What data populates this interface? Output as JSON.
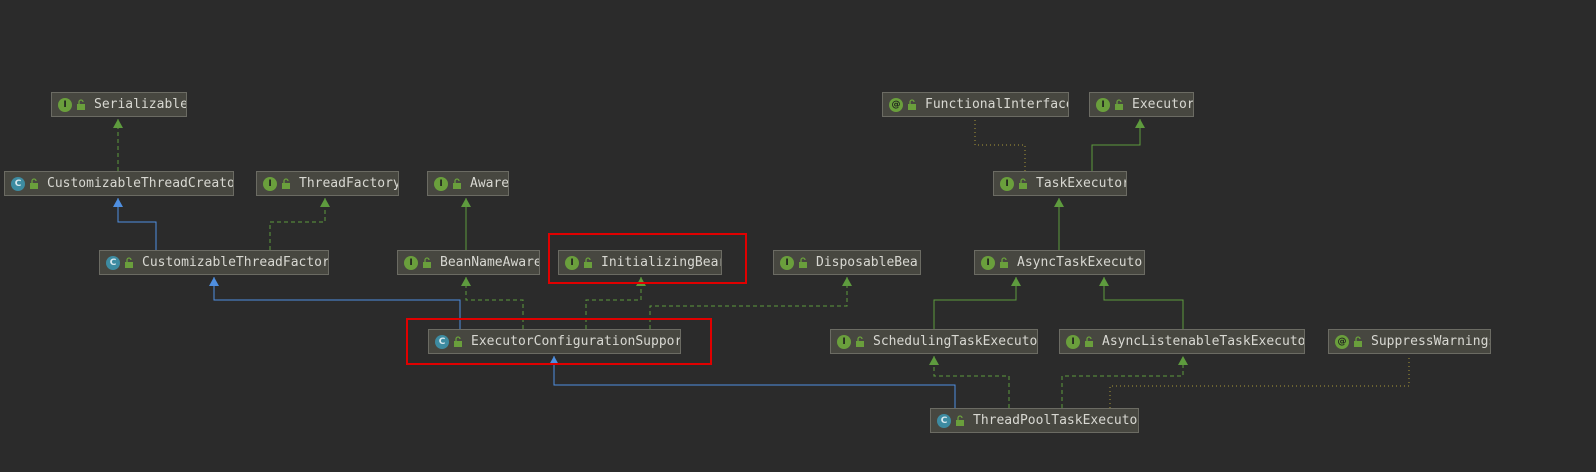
{
  "diagram": {
    "nodes": [
      {
        "id": "serializable",
        "label": "Serializable",
        "kind": "interface",
        "kind_glyph": "I"
      },
      {
        "id": "customizable-thread-creator",
        "label": "CustomizableThreadCreato",
        "kind": "class",
        "kind_glyph": "C"
      },
      {
        "id": "thread-factory",
        "label": "ThreadFactory",
        "kind": "interface",
        "kind_glyph": "I"
      },
      {
        "id": "customizable-thread-factory",
        "label": "CustomizableThreadFactor",
        "kind": "class",
        "kind_glyph": "C"
      },
      {
        "id": "aware",
        "label": "Aware",
        "kind": "interface",
        "kind_glyph": "I"
      },
      {
        "id": "bean-name-aware",
        "label": "BeanNameAware",
        "kind": "interface",
        "kind_glyph": "I"
      },
      {
        "id": "initializing-bean",
        "label": "InitializingBear",
        "kind": "interface",
        "kind_glyph": "I"
      },
      {
        "id": "disposable-bean",
        "label": "DisposableBear",
        "kind": "interface",
        "kind_glyph": "I"
      },
      {
        "id": "executor-configuration-support",
        "label": "ExecutorConfigurationSuppor",
        "kind": "class",
        "kind_glyph": "C"
      },
      {
        "id": "functional-interface",
        "label": "FunctionalInterface",
        "kind": "annotation",
        "kind_glyph": "@"
      },
      {
        "id": "executor",
        "label": "Executor",
        "kind": "interface",
        "kind_glyph": "I"
      },
      {
        "id": "task-executor",
        "label": "TaskExecutor",
        "kind": "interface",
        "kind_glyph": "I"
      },
      {
        "id": "async-task-executor",
        "label": "AsyncTaskExecutor",
        "kind": "interface",
        "kind_glyph": "I"
      },
      {
        "id": "scheduling-task-executor",
        "label": "SchedulingTaskExecuto",
        "kind": "interface",
        "kind_glyph": "I"
      },
      {
        "id": "async-listenable-task-executor",
        "label": "AsyncListenableTaskExecuto",
        "kind": "interface",
        "kind_glyph": "I"
      },
      {
        "id": "suppress-warnings",
        "label": "SuppressWarnings",
        "kind": "annotation",
        "kind_glyph": "@"
      },
      {
        "id": "thread-pool-task-executor",
        "label": "ThreadPoolTaskExecuto",
        "kind": "class",
        "kind_glyph": "C"
      }
    ],
    "edges": [
      {
        "from": "customizable-thread-creator",
        "to": "serializable",
        "type": "implements"
      },
      {
        "from": "customizable-thread-factory",
        "to": "customizable-thread-creator",
        "type": "extends"
      },
      {
        "from": "customizable-thread-factory",
        "to": "thread-factory",
        "type": "implements"
      },
      {
        "from": "bean-name-aware",
        "to": "aware",
        "type": "extends-interface"
      },
      {
        "from": "executor-configuration-support",
        "to": "customizable-thread-factory",
        "type": "extends"
      },
      {
        "from": "executor-configuration-support",
        "to": "bean-name-aware",
        "type": "implements"
      },
      {
        "from": "executor-configuration-support",
        "to": "initializing-bean",
        "type": "implements"
      },
      {
        "from": "executor-configuration-support",
        "to": "disposable-bean",
        "type": "implements"
      },
      {
        "from": "task-executor",
        "to": "functional-interface",
        "type": "annotated"
      },
      {
        "from": "task-executor",
        "to": "executor",
        "type": "extends-interface"
      },
      {
        "from": "async-task-executor",
        "to": "task-executor",
        "type": "extends-interface"
      },
      {
        "from": "scheduling-task-executor",
        "to": "async-task-executor",
        "type": "extends-interface"
      },
      {
        "from": "async-listenable-task-executor",
        "to": "async-task-executor",
        "type": "extends-interface"
      },
      {
        "from": "thread-pool-task-executor",
        "to": "executor-configuration-support",
        "type": "extends"
      },
      {
        "from": "thread-pool-task-executor",
        "to": "scheduling-task-executor",
        "type": "implements"
      },
      {
        "from": "thread-pool-task-executor",
        "to": "async-listenable-task-executor",
        "type": "implements"
      },
      {
        "from": "thread-pool-task-executor",
        "to": "suppress-warnings",
        "type": "annotated"
      }
    ],
    "highlighted": [
      "initializing-bean",
      "executor-configuration-support"
    ],
    "colors": {
      "background": "#2b2b2b",
      "node_fill": "#474740",
      "node_border": "#6b6b63",
      "node_text": "#d8d8d2",
      "interface_edge": "#5e9b3e",
      "class_edge": "#4f8fe0",
      "annotation_edge": "#a89a3a",
      "highlight": "#e00000"
    }
  }
}
